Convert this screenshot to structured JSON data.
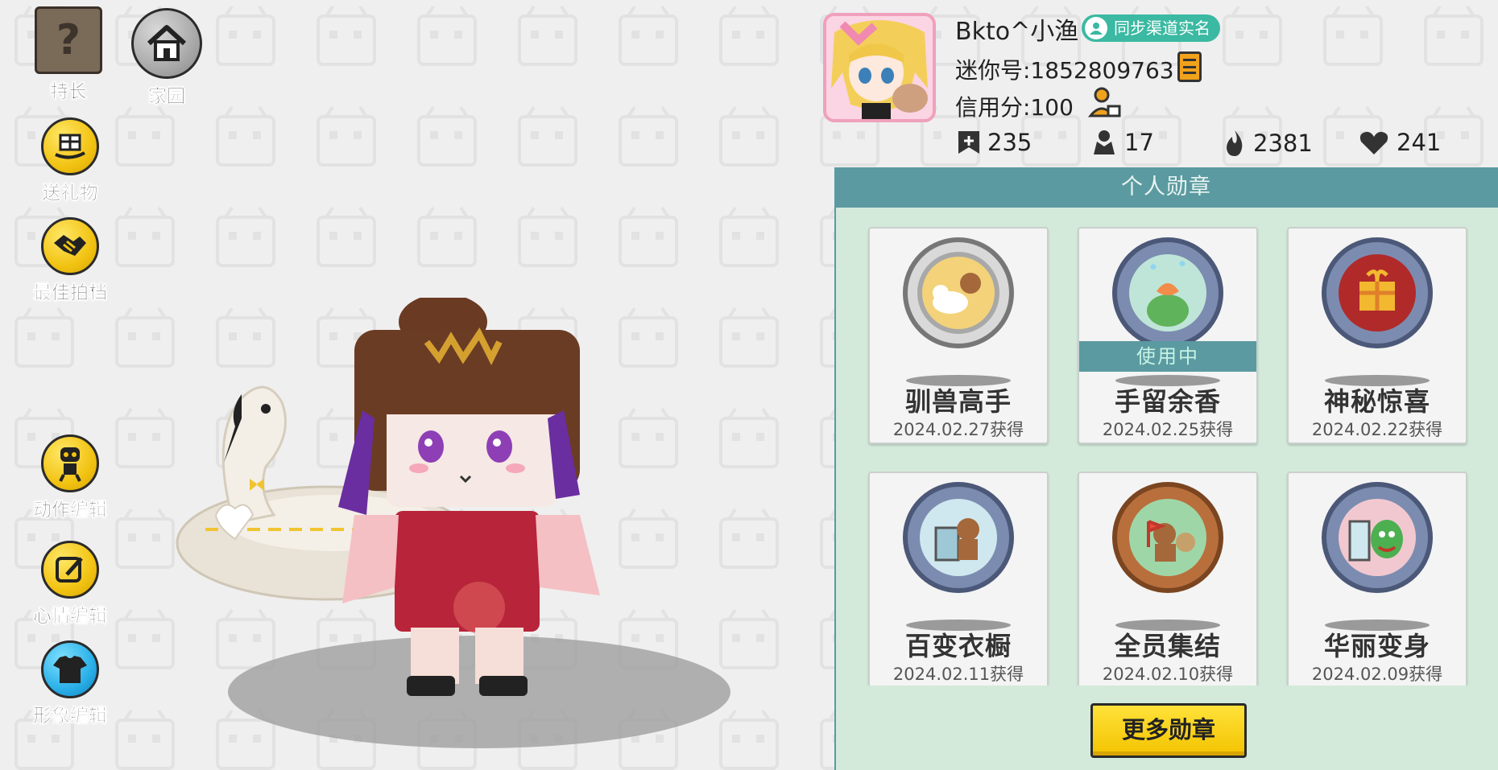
{
  "sidebar": {
    "specialty_label": "特长",
    "home_label": "家园",
    "gift_label": "送礼物",
    "partner_label": "最佳拍档",
    "action_edit_label": "动作编辑",
    "mood_edit_label": "心情编辑",
    "avatar_edit_label": "形象编辑"
  },
  "profile": {
    "name": "Bkto^小渔",
    "verify_label": "同步渠道实名",
    "mini_id": "迷你号:1852809763",
    "credit": "信用分:100"
  },
  "stats": {
    "followers": "235",
    "following": "17",
    "popularity": "2381",
    "likes": "241"
  },
  "medals": {
    "header": "个人勋章",
    "in_use_label": "使用中",
    "more_label": "更多勋章",
    "items": [
      {
        "title": "驯兽高手",
        "date": "2024.02.27获得"
      },
      {
        "title": "手留余香",
        "date": "2024.02.25获得"
      },
      {
        "title": "神秘惊喜",
        "date": "2024.02.22获得"
      },
      {
        "title": "百变衣橱",
        "date": "2024.02.11获得"
      },
      {
        "title": "全员集结",
        "date": "2024.02.10获得"
      },
      {
        "title": "华丽变身",
        "date": "2024.02.09获得"
      }
    ]
  },
  "colors": {
    "panel_bg": "#d3eadb",
    "panel_header": "#5b9aa0",
    "accent_yellow": "#f2c313",
    "verify_green": "#3bb9a2"
  }
}
